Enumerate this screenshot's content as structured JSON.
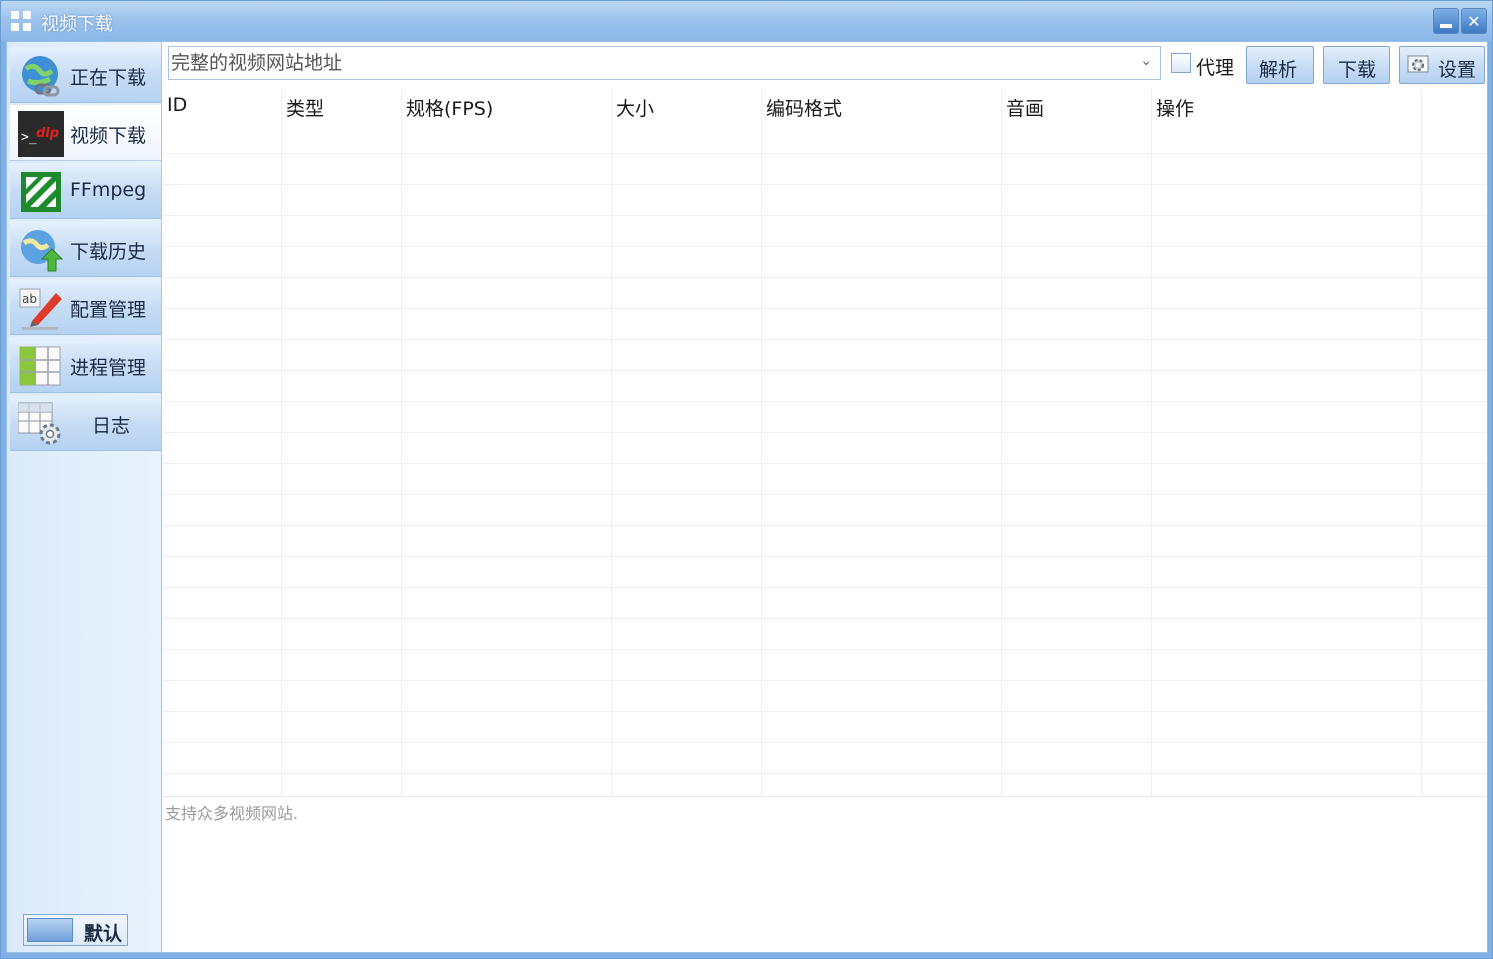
{
  "window": {
    "title": "视频下载",
    "minimize_icon": "minimize-icon",
    "close_label": "✕"
  },
  "sidebar": {
    "items": [
      {
        "label": "正在下载",
        "icon": "globe-link-icon",
        "active": false
      },
      {
        "label": "视频下载",
        "icon": "ytdlp-icon",
        "active": true
      },
      {
        "label": "FFmpeg",
        "icon": "ffmpeg-icon",
        "active": false
      },
      {
        "label": "下载历史",
        "icon": "globe-upload-icon",
        "active": false
      },
      {
        "label": "配置管理",
        "icon": "edit-marker-icon",
        "active": false
      },
      {
        "label": "进程管理",
        "icon": "table-grid-icon",
        "active": false
      },
      {
        "label": "日志",
        "icon": "table-gear-icon",
        "active": false
      }
    ],
    "theme_button": {
      "label": "默认",
      "swatch_color": "#8ab7e8"
    }
  },
  "toolbar": {
    "url_placeholder": "完整的视频网站地址",
    "url_value": "",
    "proxy_label": "代理",
    "proxy_checked": false,
    "parse_label": "解析",
    "download_label": "下载",
    "settings_label": "设置"
  },
  "table": {
    "columns": [
      "ID",
      "类型",
      "规格(FPS)",
      "大小",
      "编码格式",
      "音画",
      "操作"
    ],
    "rows": []
  },
  "status": {
    "text": "支持众多视频网站."
  },
  "colors": {
    "titlebar": "#9cc3ec",
    "sidebar_bg": "#dbeaf9",
    "button_face": "#c9def5",
    "grid_line": "#eef1f4"
  }
}
